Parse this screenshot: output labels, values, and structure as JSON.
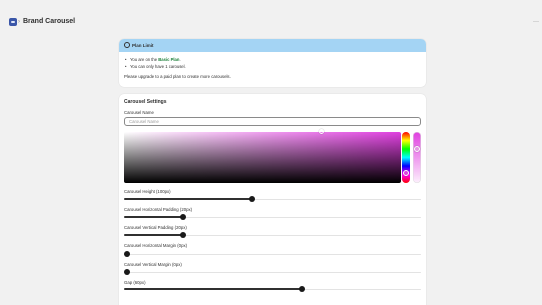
{
  "header": {
    "breadcrumb_sep": "›",
    "title": "Brand Carousel",
    "more_label": "···",
    "app_icon": "app-icon"
  },
  "plan_banner": {
    "title": "Plan Limit",
    "icon": "info-icon",
    "line1_prefix": "You are on the ",
    "line1_plan": "Basic Plan",
    "line1_suffix": ".",
    "line2": "You can only have 1 carousel.",
    "note": "Please upgrade to a paid plan to create more carousels.",
    "colors": {
      "banner": "#a4d4f4",
      "plan_text": "#1a7f37"
    }
  },
  "settings": {
    "title": "Carousel Settings",
    "name_label": "Carousel Name",
    "name_placeholder": "Carousel Name",
    "name_value": "",
    "color": {
      "selected": "#e040e0",
      "hue": "magenta"
    },
    "sliders": [
      {
        "label": "Carousel Height (100px)",
        "fraction": 0.43
      },
      {
        "label": "Carousel Horizontal Padding (20px)",
        "fraction": 0.2
      },
      {
        "label": "Carousel Vertical Padding (20px)",
        "fraction": 0.2
      },
      {
        "label": "Carousel Horizontal Margin (0px)",
        "fraction": 0.0
      },
      {
        "label": "Carousel Vertical Margin (0px)",
        "fraction": 0.0
      },
      {
        "label": "Gap (60px)",
        "fraction": 0.6
      }
    ]
  }
}
